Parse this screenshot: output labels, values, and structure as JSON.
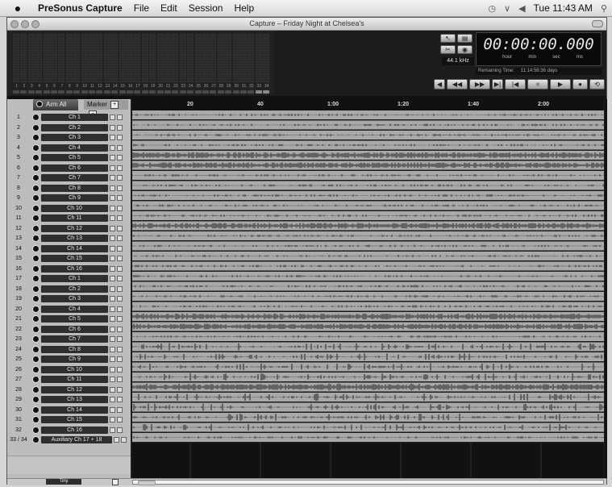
{
  "menubar": {
    "apple": "",
    "app_name": "PreSonus Capture",
    "items": [
      "File",
      "Edit",
      "Session",
      "Help"
    ],
    "clock": "Tue 11:43 AM"
  },
  "window": {
    "title": "Capture – Friday Night at Chelsea's"
  },
  "meters": {
    "channels": [
      "1",
      "2",
      "3",
      "4",
      "5",
      "6",
      "7",
      "8",
      "9",
      "10",
      "11",
      "12",
      "13",
      "14",
      "15",
      "16",
      "17",
      "18",
      "19",
      "20",
      "21",
      "22",
      "23",
      "24",
      "25",
      "26",
      "27",
      "28",
      "29",
      "30",
      "31",
      "32",
      "33",
      "34"
    ]
  },
  "transport": {
    "timecode": "00:00:00.000",
    "units": [
      "hour",
      "min",
      "sec",
      "ms"
    ],
    "sample_rate": "44.1 kHz",
    "remaining_label": "Remaining Time:",
    "remaining_value": "11:14:56:36 days",
    "buttons": [
      "◀",
      "◀◀",
      "▶▶",
      "▶|",
      "|◀",
      "■",
      "▶",
      "●",
      "⟲"
    ]
  },
  "tracks_header": {
    "arm_all": "Arm All",
    "marker": "Marker"
  },
  "ruler": {
    "labels": [
      "20",
      "40",
      "1:00",
      "1:20",
      "1:40",
      "2:00",
      "2:"
    ]
  },
  "tracks": [
    {
      "num": "1",
      "name": "Ch 1"
    },
    {
      "num": "2",
      "name": "Ch 2"
    },
    {
      "num": "3",
      "name": "Ch 3"
    },
    {
      "num": "4",
      "name": "Ch 4"
    },
    {
      "num": "5",
      "name": "Ch 5"
    },
    {
      "num": "6",
      "name": "Ch 6"
    },
    {
      "num": "7",
      "name": "Ch 7"
    },
    {
      "num": "8",
      "name": "Ch 8"
    },
    {
      "num": "9",
      "name": "Ch 9"
    },
    {
      "num": "10",
      "name": "Ch 10"
    },
    {
      "num": "11",
      "name": "Ch 11"
    },
    {
      "num": "12",
      "name": "Ch 12"
    },
    {
      "num": "13",
      "name": "Ch 13"
    },
    {
      "num": "14",
      "name": "Ch 14"
    },
    {
      "num": "15",
      "name": "Ch 15"
    },
    {
      "num": "16",
      "name": "Ch 16"
    },
    {
      "num": "17",
      "name": "Ch 1"
    },
    {
      "num": "18",
      "name": "Ch 2"
    },
    {
      "num": "19",
      "name": "Ch 3"
    },
    {
      "num": "20",
      "name": "Ch 4"
    },
    {
      "num": "21",
      "name": "Ch 5"
    },
    {
      "num": "22",
      "name": "Ch 6"
    },
    {
      "num": "23",
      "name": "Ch 7"
    },
    {
      "num": "24",
      "name": "Ch 8"
    },
    {
      "num": "25",
      "name": "Ch 9"
    },
    {
      "num": "26",
      "name": "Ch 10"
    },
    {
      "num": "27",
      "name": "Ch 11"
    },
    {
      "num": "28",
      "name": "Ch 12"
    },
    {
      "num": "29",
      "name": "Ch 13"
    },
    {
      "num": "30",
      "name": "Ch 14"
    },
    {
      "num": "31",
      "name": "Ch 15"
    },
    {
      "num": "32",
      "name": "Ch 16"
    },
    {
      "num": "33 / 34",
      "name": "Auxiliary Ch 17 + 18"
    }
  ],
  "bottom": {
    "zoom_label": "Tiny"
  }
}
